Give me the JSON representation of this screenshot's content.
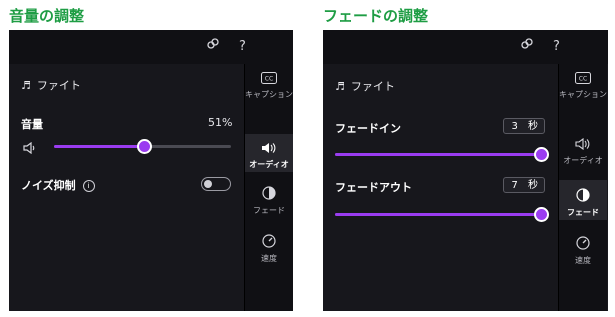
{
  "left": {
    "heading": "音量の調整",
    "file_name": "ファイト",
    "volume": {
      "label": "音量",
      "value_text": "51%",
      "level": 0.51
    },
    "noise": {
      "label": "ノイズ抑制",
      "enabled": false
    },
    "sidebar": [
      {
        "label": "キャプション",
        "icon": "cc-icon"
      },
      {
        "label": "オーディオ",
        "icon": "speaker-icon",
        "active": true
      },
      {
        "label": "フェード",
        "icon": "fade-icon"
      },
      {
        "label": "速度",
        "icon": "speed-icon"
      }
    ]
  },
  "right": {
    "heading": "フェードの調整",
    "file_name": "ファイト",
    "fade_in": {
      "label": "フェードイン",
      "value": "3",
      "unit": "秒",
      "level": 1.0
    },
    "fade_out": {
      "label": "フェードアウト",
      "value": "7",
      "unit": "秒",
      "level": 1.0
    },
    "sidebar": [
      {
        "label": "キャプション",
        "icon": "cc-icon"
      },
      {
        "label": "オーディオ",
        "icon": "speaker-icon"
      },
      {
        "label": "フェード",
        "icon": "fade-icon",
        "active": true
      },
      {
        "label": "速度",
        "icon": "speed-icon"
      }
    ]
  },
  "top_icons": {
    "help": "?"
  },
  "colors": {
    "accent": "#9a3cf0",
    "heading": "#1e9d44",
    "panel": "#17171c"
  }
}
